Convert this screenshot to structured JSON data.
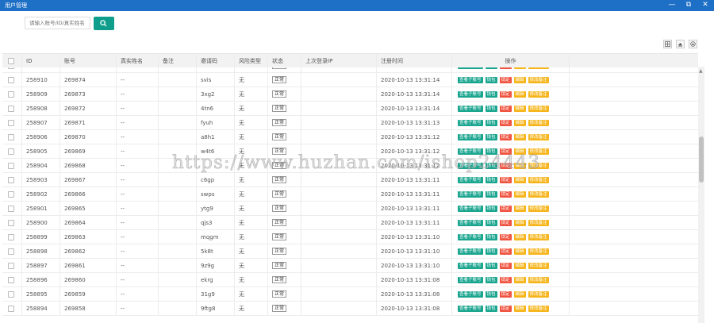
{
  "window": {
    "title": "用户管理",
    "minimize": "—",
    "restore": "⧉",
    "close": "✕"
  },
  "search": {
    "placeholder": "请输入账号/ID/真实姓名"
  },
  "accent": "#109e8c",
  "columns": [
    "ID",
    "账号",
    "真实姓名",
    "备注",
    "邀请码",
    "风险类型",
    "状态",
    "上次登录IP",
    "注册时间",
    "操作"
  ],
  "actions": [
    "查看子账号",
    "钱包",
    "锁定",
    "编辑",
    "修改备注"
  ],
  "rows": [
    {
      "id": "",
      "account": "",
      "real_name": "",
      "note": "",
      "code": "",
      "risk": "",
      "status": "正常",
      "ip": "",
      "time": "",
      "partial": true
    },
    {
      "id": "258910",
      "account": "269874",
      "real_name": "--",
      "note": "",
      "code": "svis",
      "risk": "无",
      "status": "正常",
      "ip": "",
      "time": "2020-10-13 13:31:14"
    },
    {
      "id": "258909",
      "account": "269873",
      "real_name": "--",
      "note": "",
      "code": "3xg2",
      "risk": "无",
      "status": "正常",
      "ip": "",
      "time": "2020-10-13 13:31:14"
    },
    {
      "id": "258908",
      "account": "269872",
      "real_name": "--",
      "note": "",
      "code": "4tn6",
      "risk": "无",
      "status": "正常",
      "ip": "",
      "time": "2020-10-13 13:31:14"
    },
    {
      "id": "258907",
      "account": "269871",
      "real_name": "--",
      "note": "",
      "code": "fyuh",
      "risk": "无",
      "status": "正常",
      "ip": "",
      "time": "2020-10-13 13:31:13"
    },
    {
      "id": "258906",
      "account": "269870",
      "real_name": "--",
      "note": "",
      "code": "a8h1",
      "risk": "无",
      "status": "正常",
      "ip": "",
      "time": "2020-10-13 13:31:12"
    },
    {
      "id": "258905",
      "account": "269869",
      "real_name": "--",
      "note": "",
      "code": "w4t6",
      "risk": "无",
      "status": "正常",
      "ip": "",
      "time": "2020-10-13 13:31:12"
    },
    {
      "id": "258904",
      "account": "269868",
      "real_name": "--",
      "note": "",
      "code": "",
      "risk": "无",
      "status": "正常",
      "ip": "",
      "time": "2020-10-13 13:31:12"
    },
    {
      "id": "258903",
      "account": "269867",
      "real_name": "--",
      "note": "",
      "code": "c6gp",
      "risk": "无",
      "status": "正常",
      "ip": "",
      "time": "2020-10-13 13:31:11"
    },
    {
      "id": "258902",
      "account": "269866",
      "real_name": "--",
      "note": "",
      "code": "swps",
      "risk": "无",
      "status": "正常",
      "ip": "",
      "time": "2020-10-13 13:31:11"
    },
    {
      "id": "258901",
      "account": "269865",
      "real_name": "--",
      "note": "",
      "code": "ytg9",
      "risk": "无",
      "status": "正常",
      "ip": "",
      "time": "2020-10-13 13:31:11"
    },
    {
      "id": "258900",
      "account": "269864",
      "real_name": "--",
      "note": "",
      "code": "qjs3",
      "risk": "无",
      "status": "正常",
      "ip": "",
      "time": "2020-10-13 13:31:11"
    },
    {
      "id": "258899",
      "account": "269863",
      "real_name": "--",
      "note": "",
      "code": "mqgm",
      "risk": "无",
      "status": "正常",
      "ip": "",
      "time": "2020-10-13 13:31:10"
    },
    {
      "id": "258898",
      "account": "269862",
      "real_name": "--",
      "note": "",
      "code": "5k8t",
      "risk": "无",
      "status": "正常",
      "ip": "",
      "time": "2020-10-13 13:31:10"
    },
    {
      "id": "258897",
      "account": "269861",
      "real_name": "--",
      "note": "",
      "code": "9z9g",
      "risk": "无",
      "status": "正常",
      "ip": "",
      "time": "2020-10-13 13:31:10"
    },
    {
      "id": "258896",
      "account": "269860",
      "real_name": "--",
      "note": "",
      "code": "ekrg",
      "risk": "无",
      "status": "正常",
      "ip": "",
      "time": "2020-10-13 13:31:08"
    },
    {
      "id": "258895",
      "account": "269859",
      "real_name": "--",
      "note": "",
      "code": "31g9",
      "risk": "无",
      "status": "正常",
      "ip": "",
      "time": "2020-10-13 13:31:08"
    },
    {
      "id": "258894",
      "account": "269858",
      "real_name": "--",
      "note": "",
      "code": "9ftg8",
      "risk": "无",
      "status": "正常",
      "ip": "",
      "time": "2020-10-13 13:31:08"
    }
  ],
  "watermark": "https://www.huzhan.com/ishop24443"
}
